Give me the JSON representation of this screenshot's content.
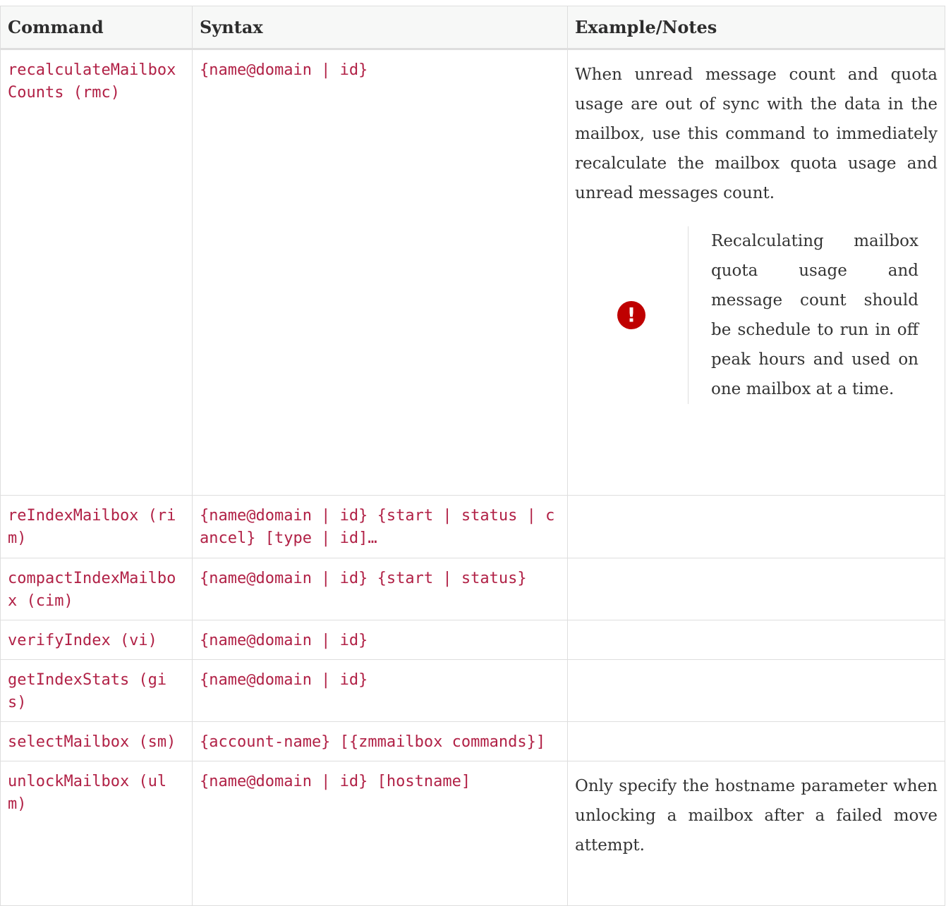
{
  "table": {
    "headers": [
      "Command",
      "Syntax",
      "Example/Notes"
    ],
    "rows": [
      {
        "command": "recalculateMailboxCounts (rmc)",
        "syntax": "{name@domain | id}",
        "notes": "When unread message count and quota usage are out of sync with the data in the mailbox, use this command to immediately recalculate the mailbox quota usage and unread messages count.",
        "warning": {
          "icon": "exclamation-icon",
          "text": "Recalculating mailbox quota usage and message count should be schedule to run in off peak hours and used on one mailbox at a time."
        }
      },
      {
        "command": "reIndexMailbox (rim)",
        "syntax": "{name@domain | id} {start | status | cancel} [type | id]…",
        "notes": ""
      },
      {
        "command": "compactIndexMailbox (cim)",
        "syntax": "{name@domain | id} {start | status}",
        "notes": ""
      },
      {
        "command": "verifyIndex (vi)",
        "syntax": "{name@domain | id}",
        "notes": ""
      },
      {
        "command": "getIndexStats (gis)",
        "syntax": "{name@domain | id}",
        "notes": ""
      },
      {
        "command": "selectMailbox (sm)",
        "syntax": "{account-name} [{zmmailbox commands}]",
        "notes": ""
      },
      {
        "command": "unlockMailbox (ulm)",
        "syntax": "{name@domain | id} [hostname]",
        "notes": "Only specify the hostname parameter when unlocking a mailbox after a failed move attempt."
      }
    ]
  },
  "colors": {
    "code": "#b12146",
    "warning_icon": "#bf0000",
    "border": "#dedede",
    "header_bg": "#f7f8f7"
  }
}
